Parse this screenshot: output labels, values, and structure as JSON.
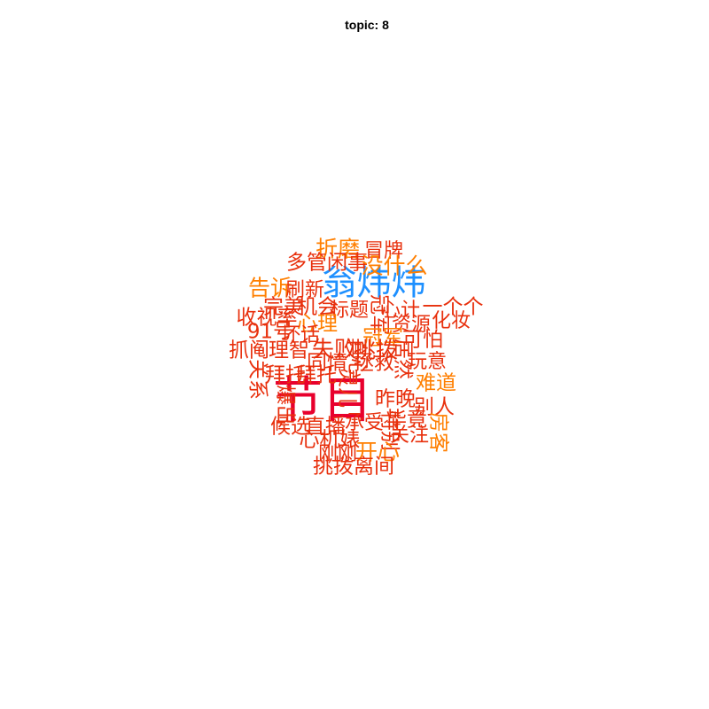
{
  "chart_data": {
    "type": "wordcloud",
    "title": "topic: 8",
    "words": [
      {
        "text": "节目",
        "weight": 1.0,
        "color": "#e8002d",
        "vertical": false
      },
      {
        "text": "翁炜炜",
        "weight": 0.6,
        "color": "#1e90ff",
        "vertical": false
      },
      {
        "text": "折磨",
        "weight": 0.25,
        "color": "#ff7f00",
        "vertical": false
      },
      {
        "text": "冒牌",
        "weight": 0.2,
        "color": "#e8300d",
        "vertical": false
      },
      {
        "text": "多管闲事",
        "weight": 0.22,
        "color": "#e8300d",
        "vertical": false
      },
      {
        "text": "没什么",
        "weight": 0.25,
        "color": "#ff7f00",
        "vertical": false
      },
      {
        "text": "告诉",
        "weight": 0.25,
        "color": "#ff7f00",
        "vertical": false
      },
      {
        "text": "刷新",
        "weight": 0.2,
        "color": "#e8300d",
        "vertical": false
      },
      {
        "text": "完美",
        "weight": 0.22,
        "color": "#e8300d",
        "vertical": false
      },
      {
        "text": "机会",
        "weight": 0.22,
        "color": "#e8300d",
        "vertical": false
      },
      {
        "text": "标题",
        "weight": 0.2,
        "color": "#e8300d",
        "vertical": false
      },
      {
        "text": "冠军",
        "weight": 0.22,
        "color": "#e8300d",
        "vertical": true
      },
      {
        "text": "心计",
        "weight": 0.2,
        "color": "#e8300d",
        "vertical": false
      },
      {
        "text": "一个个",
        "weight": 0.22,
        "color": "#e8300d",
        "vertical": false
      },
      {
        "text": "收视率",
        "weight": 0.22,
        "color": "#e8300d",
        "vertical": false
      },
      {
        "text": "心理",
        "weight": 0.22,
        "color": "#ff7f00",
        "vertical": false
      },
      {
        "text": "资源",
        "weight": 0.2,
        "color": "#e8300d",
        "vertical": false
      },
      {
        "text": "化妆",
        "weight": 0.2,
        "color": "#e8300d",
        "vertical": false
      },
      {
        "text": "91号",
        "weight": 0.22,
        "color": "#e8300d",
        "vertical": false
      },
      {
        "text": "坏话",
        "weight": 0.2,
        "color": "#e8300d",
        "vertical": false
      },
      {
        "text": "冠军",
        "weight": 0.22,
        "color": "#ff7f00",
        "vertical": false
      },
      {
        "text": "可怕",
        "weight": 0.22,
        "color": "#e8300d",
        "vertical": false
      },
      {
        "text": "抓阄",
        "weight": 0.22,
        "color": "#e8300d",
        "vertical": false
      },
      {
        "text": "理智",
        "weight": 0.22,
        "color": "#e8300d",
        "vertical": false
      },
      {
        "text": "失败",
        "weight": 0.25,
        "color": "#e8300d",
        "vertical": false
      },
      {
        "text": "挑拨",
        "weight": 0.25,
        "color": "#e8300d",
        "vertical": false
      },
      {
        "text": "同情",
        "weight": 0.22,
        "color": "#e8300d",
        "vertical": false
      },
      {
        "text": "真心",
        "weight": 0.22,
        "color": "#e8300d",
        "vertical": true
      },
      {
        "text": "拯救",
        "weight": 0.22,
        "color": "#e8300d",
        "vertical": false
      },
      {
        "text": "居然",
        "weight": 0.22,
        "color": "#e8300d",
        "vertical": true
      },
      {
        "text": "玩意",
        "weight": 0.2,
        "color": "#e8300d",
        "vertical": false
      },
      {
        "text": "关系",
        "weight": 0.22,
        "color": "#e8300d",
        "vertical": true
      },
      {
        "text": "拜托",
        "weight": 0.22,
        "color": "#e8300d",
        "vertical": false
      },
      {
        "text": "拜托",
        "weight": 0.22,
        "color": "#e8300d",
        "vertical": false
      },
      {
        "text": "灵儿",
        "weight": 0.22,
        "color": "#e8300d",
        "vertical": true
      },
      {
        "text": "难道",
        "weight": 0.22,
        "color": "#ff7f00",
        "vertical": false
      },
      {
        "text": "爆出",
        "weight": 0.22,
        "color": "#e8300d",
        "vertical": true
      },
      {
        "text": "昨晚",
        "weight": 0.22,
        "color": "#e8300d",
        "vertical": false
      },
      {
        "text": "别人",
        "weight": 0.22,
        "color": "#e8300d",
        "vertical": false
      },
      {
        "text": "候选",
        "weight": 0.22,
        "color": "#e8300d",
        "vertical": false
      },
      {
        "text": "直播",
        "weight": 0.22,
        "color": "#e8300d",
        "vertical": false
      },
      {
        "text": "承受",
        "weight": 0.2,
        "color": "#e8300d",
        "vertical": false
      },
      {
        "text": "毕竟",
        "weight": 0.22,
        "color": "#e8300d",
        "vertical": false
      },
      {
        "text": "特别",
        "weight": 0.22,
        "color": "#e8300d",
        "vertical": true
      },
      {
        "text": "关注",
        "weight": 0.2,
        "color": "#e8300d",
        "vertical": false
      },
      {
        "text": "房客",
        "weight": 0.22,
        "color": "#ff7f00",
        "vertical": true
      },
      {
        "text": "心机婊",
        "weight": 0.22,
        "color": "#e8300d",
        "vertical": false
      },
      {
        "text": "开心",
        "weight": 0.25,
        "color": "#ff7f00",
        "vertical": false
      },
      {
        "text": "刚刚",
        "weight": 0.2,
        "color": "#e8300d",
        "vertical": false
      },
      {
        "text": "挑拨离间",
        "weight": 0.22,
        "color": "#e8300d",
        "vertical": false
      }
    ]
  }
}
